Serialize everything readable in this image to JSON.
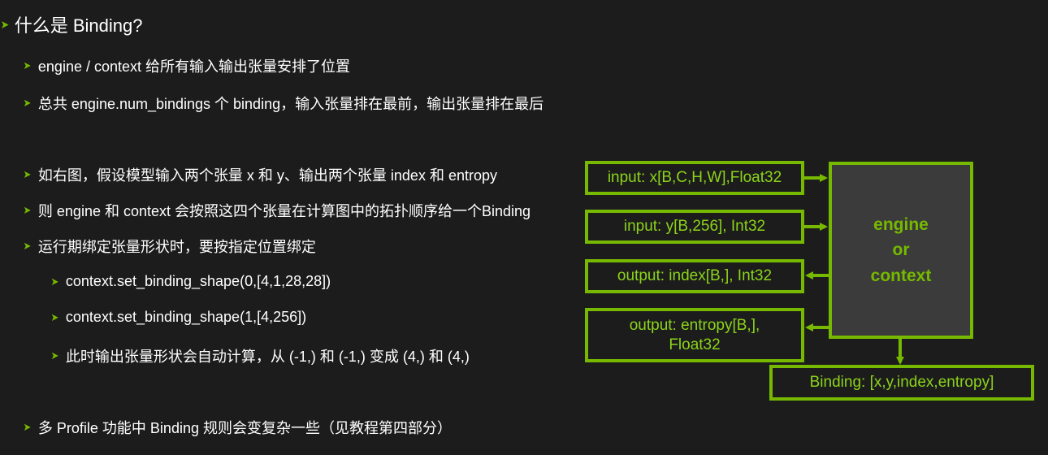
{
  "title": "什么是 Binding?",
  "bullets": [
    "engine / context 给所有输入输出张量安排了位置",
    "总共 engine.num_bindings 个 binding，输入张量排在最前，输出张量排在最后",
    "如右图，假设模型输入两个张量 x 和 y、输出两个张量 index 和 entropy",
    "则 engine 和 context 会按照这四个张量在计算图中的拓扑顺序给一个Binding",
    "运行期绑定张量形状时，要按指定位置绑定"
  ],
  "sub_bullets": [
    "context.set_binding_shape(0,[4,1,28,28])",
    "context.set_binding_shape(1,[4,256])",
    "此时输出张量形状会自动计算，从 (-1,) 和 (-1,) 变成 (4,) 和 (4,)"
  ],
  "last_bullet": "多 Profile 功能中 Binding 规则会变复杂一些（见教程第四部分）",
  "diagram": {
    "inputs": [
      "input: x[B,C,H,W],Float32",
      "input: y[B,256], Int32"
    ],
    "outputs": [
      "output: index[B,], Int32",
      "output: entropy[B,],",
      "Float32"
    ],
    "engine_lines": [
      "engine",
      "or",
      "context"
    ],
    "binding": "Binding: [x,y,index,entropy]"
  },
  "colors": {
    "accent": "#76b900",
    "background": "#1c1c1c",
    "engine_fill": "#3b3b3b"
  },
  "icons": {
    "bullet": "green-arrow-icon"
  }
}
